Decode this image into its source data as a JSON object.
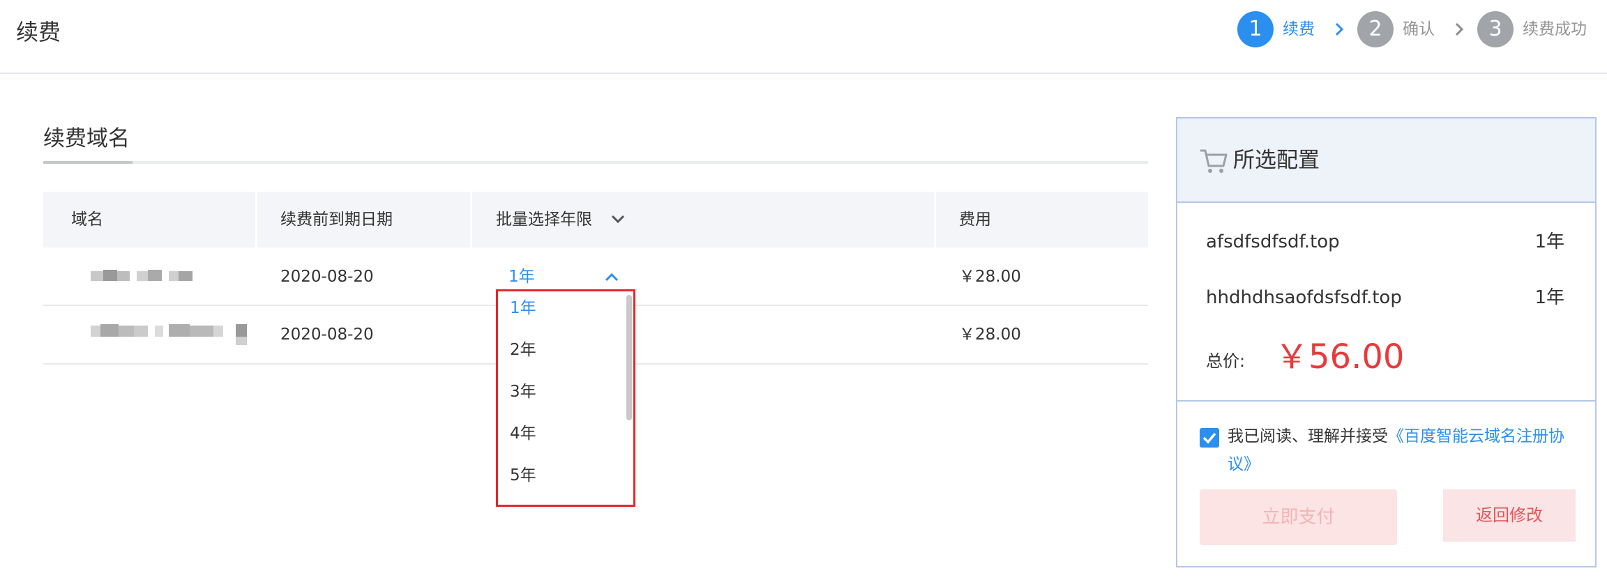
{
  "header": {
    "title": "续费",
    "steps": [
      {
        "number": "1",
        "label": "续费",
        "state": "active"
      },
      {
        "number": "2",
        "label": "确认",
        "state": "idle"
      },
      {
        "number": "3",
        "label": "续费成功",
        "state": "idle"
      }
    ]
  },
  "section": {
    "title": "续费域名"
  },
  "table": {
    "columns": [
      "域名",
      "续费前到期日期",
      "批量选择年限",
      "费用"
    ],
    "rows": [
      {
        "domain": "",
        "expiry": "2020-08-20",
        "years": "1年",
        "fee": "￥28.00"
      },
      {
        "domain": "",
        "expiry": "2020-08-20",
        "years": "",
        "fee": "￥28.00"
      }
    ]
  },
  "year_dropdown": {
    "selected": "1年",
    "options": [
      "1年",
      "2年",
      "3年",
      "4年",
      "5年"
    ]
  },
  "summary": {
    "title": "所选配置",
    "items": [
      {
        "domain": "afsdfsdfsdf.top",
        "years": "1年"
      },
      {
        "domain": "hhdhdhsaofdsfsdf.top",
        "years": "1年"
      }
    ],
    "total_label": "总价:",
    "total_value": "￥56.00",
    "agree_text": "我已阅读、理解并接受",
    "agree_link": "《百度智能云域名注册协议》",
    "agree_checked": true,
    "pay_button": "立即支付",
    "back_button": "返回修改"
  },
  "colors": {
    "accent": "#2b8ff0",
    "price": "#e83a3c",
    "highlight_border": "#e6262a"
  }
}
